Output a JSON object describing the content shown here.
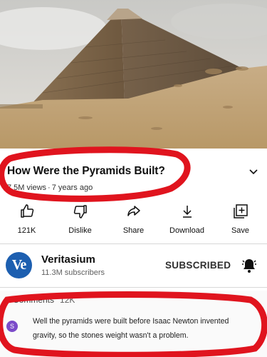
{
  "video": {
    "thumbnail": "great-pyramid-of-giza"
  },
  "header": {
    "title": "How Were the Pyramids Built?",
    "views": "7.5M views",
    "age": "7 years ago",
    "separator": "·"
  },
  "actions": [
    {
      "label": "121K",
      "icon": "thumbs-up-icon"
    },
    {
      "label": "Dislike",
      "icon": "thumbs-down-icon"
    },
    {
      "label": "Share",
      "icon": "share-icon"
    },
    {
      "label": "Download",
      "icon": "download-icon"
    },
    {
      "label": "Save",
      "icon": "save-to-playlist-icon"
    }
  ],
  "channel": {
    "avatar_text": "Ve",
    "name": "Veritasium",
    "subscribers": "11.3M subscribers",
    "subscribe_state": "SUBSCRIBED"
  },
  "comments": {
    "header": "Comments",
    "count": "12K",
    "avatar_initial": "S",
    "text": "Well the pyramids were built before Isaac Newton invented gravity, so the stones weight wasn't a problem."
  },
  "colors": {
    "marker": "#e0141e",
    "avatar": "#1d5fb0",
    "comment_avatar": "#7b4bc9"
  }
}
